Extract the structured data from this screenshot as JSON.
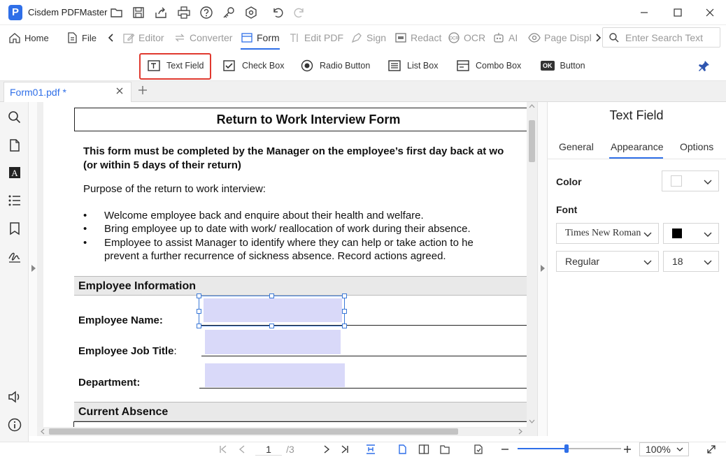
{
  "app": {
    "logo_letter": "P",
    "name": "Cisdem PDFMaster"
  },
  "main_toolbar": {
    "home": "Home",
    "file": "File",
    "editor": "Editor",
    "converter": "Converter",
    "form": "Form",
    "edit_pdf": "Edit PDF",
    "sign": "Sign",
    "redact": "Redact",
    "ocr": "OCR",
    "ai": "AI",
    "page_display": "Page Displ",
    "search_placeholder": "Enter Search Text"
  },
  "form_toolbar": {
    "text_field": "Text Field",
    "check_box": "Check Box",
    "radio_button": "Radio Button",
    "list_box": "List Box",
    "combo_box": "Combo Box",
    "button_icon_text": "OK",
    "button": "Button"
  },
  "tabs": [
    {
      "label": "Form01.pdf *"
    }
  ],
  "document": {
    "title": "Return to Work Interview Form",
    "intro_line1": "This form must be completed by the Manager on the employee’s first day back at wo",
    "intro_line2": "(or within 5 days of their return)",
    "purpose": "Purpose of the return to work interview:",
    "bullet_char": "•",
    "bullets": [
      "Welcome employee back and enquire about their health and welfare.",
      "Bring employee up to date with work/ reallocation of work during their absence.",
      "Employee  to  assist  Manager  to  identify  where  they  can  help  or  take  action  to  he",
      "prevent a further recurrence of sickness absence. Record actions agreed."
    ],
    "section_employee": "Employee Information",
    "label_name": "Employee Name:",
    "label_job_title": "Employee Job Title",
    "label_job_colon": ":",
    "label_department": "Department:",
    "section_absence": "Current Absence"
  },
  "properties_panel": {
    "title": "Text Field",
    "tabs": [
      "General",
      "Appearance",
      "Options"
    ],
    "active_tab": "Appearance",
    "color_label": "Color",
    "color_value": "#ffffff",
    "font_label": "Font",
    "font_family": "Times New Roman",
    "font_color": "#000000",
    "font_style": "Regular",
    "font_size": "18"
  },
  "status_bar": {
    "current_page": "1",
    "total_pages": "/3",
    "zoom": "100%",
    "zoom_fraction": 0.47
  },
  "colors": {
    "accent": "#2f6fe8",
    "highlight": "#e0392f",
    "field_fill": "#d9d9f9"
  }
}
